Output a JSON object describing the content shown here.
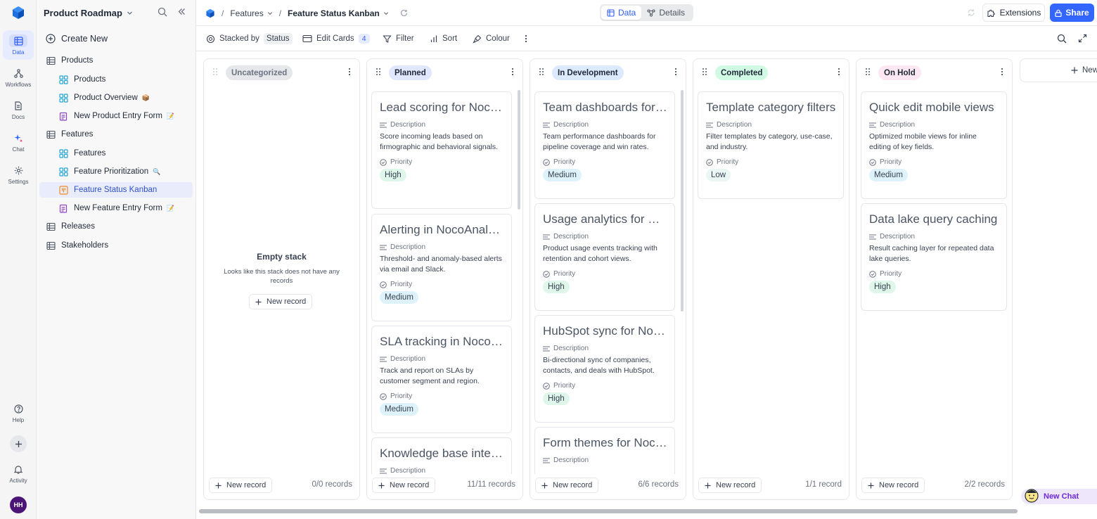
{
  "rail": {
    "items": [
      {
        "label": "Data"
      },
      {
        "label": "Workflows"
      },
      {
        "label": "Docs"
      },
      {
        "label": "Chat"
      },
      {
        "label": "Settings"
      }
    ],
    "help": "Help",
    "activity": "Activity",
    "avatar": "HH"
  },
  "sidebar": {
    "title": "Product Roadmap",
    "create_new": "Create New",
    "items": [
      {
        "label": "Products",
        "kind": "table"
      },
      {
        "label": "Products",
        "kind": "grid"
      },
      {
        "label": "Product Overview",
        "kind": "grid",
        "emoji": "📦"
      },
      {
        "label": "New Product Entry Form",
        "kind": "form",
        "emoji": "📝"
      },
      {
        "label": "Features",
        "kind": "table"
      },
      {
        "label": "Features",
        "kind": "grid"
      },
      {
        "label": "Feature Prioritization",
        "kind": "grid",
        "emoji": "🔍"
      },
      {
        "label": "Feature Status Kanban",
        "kind": "kanban"
      },
      {
        "label": "New Feature Entry Form",
        "kind": "form",
        "emoji": "📝"
      },
      {
        "label": "Releases",
        "kind": "table"
      },
      {
        "label": "Stakeholders",
        "kind": "table"
      }
    ]
  },
  "topbar": {
    "crumb_table": "Features",
    "crumb_view": "Feature Status Kanban",
    "tab_data": "Data",
    "tab_details": "Details",
    "extensions": "Extensions",
    "share": "Share"
  },
  "toolbar": {
    "stacked_by": "Stacked by",
    "stacked_field": "Status",
    "edit_cards": "Edit Cards",
    "edit_cards_count": "4",
    "filter": "Filter",
    "sort": "Sort",
    "colour": "Colour"
  },
  "labels": {
    "description": "Description",
    "priority": "Priority",
    "new_record": "New record",
    "empty_title": "Empty stack",
    "empty_text": "Looks like this stack does not have any records",
    "new_stack": "New",
    "new_chat": "New Chat"
  },
  "colors": {
    "accent": "#3366ff",
    "uncategorized": "#e5e7eb",
    "planned": "#e0e7ff",
    "in_development": "#dbeafe",
    "completed": "#d1fae5",
    "on_hold": "#fce7f3"
  },
  "stacks": [
    {
      "name": "Uncategorized",
      "count": "0/0 records",
      "cards": []
    },
    {
      "name": "Planned",
      "count": "11/11 records",
      "cards": [
        {
          "title": "Lead scoring for NocoCRM",
          "description": "Score incoming leads based on firmographic and behavioral signals.",
          "priority": "High"
        },
        {
          "title": "Alerting in NocoAnalytics",
          "description": "Threshold- and anomaly-based alerts via email and Slack.",
          "priority": "Medium"
        },
        {
          "title": "SLA tracking in NocoDesk",
          "description": "Track and report on SLAs by customer segment and region.",
          "priority": "Medium"
        },
        {
          "title": "Knowledge base integration",
          "description": "",
          "priority": ""
        }
      ]
    },
    {
      "name": "In Development",
      "count": "6/6 records",
      "cards": [
        {
          "title": "Team dashboards for NocoCRM",
          "description": "Team performance dashboards for pipeline coverage and win rates.",
          "priority": "Medium"
        },
        {
          "title": "Usage analytics for NocoAnalytics",
          "description": "Product usage events tracking with retention and cohort views.",
          "priority": "High"
        },
        {
          "title": "HubSpot sync for NocoCRM",
          "description": "Bi-directional sync of companies, contacts, and deals with HubSpot.",
          "priority": "High"
        },
        {
          "title": "Form themes for NocoForms",
          "description": "",
          "priority": ""
        }
      ]
    },
    {
      "name": "Completed",
      "count": "1/1 record",
      "cards": [
        {
          "title": "Template category filters",
          "description": "Filter templates by category, use-case, and industry.",
          "priority": "Low"
        }
      ]
    },
    {
      "name": "On Hold",
      "count": "2/2 records",
      "cards": [
        {
          "title": "Quick edit mobile views",
          "description": "Optimized mobile views for inline editing of key fields.",
          "priority": "Medium"
        },
        {
          "title": "Data lake query caching",
          "description": "Result caching layer for repeated data lake queries.",
          "priority": "High"
        }
      ]
    }
  ]
}
